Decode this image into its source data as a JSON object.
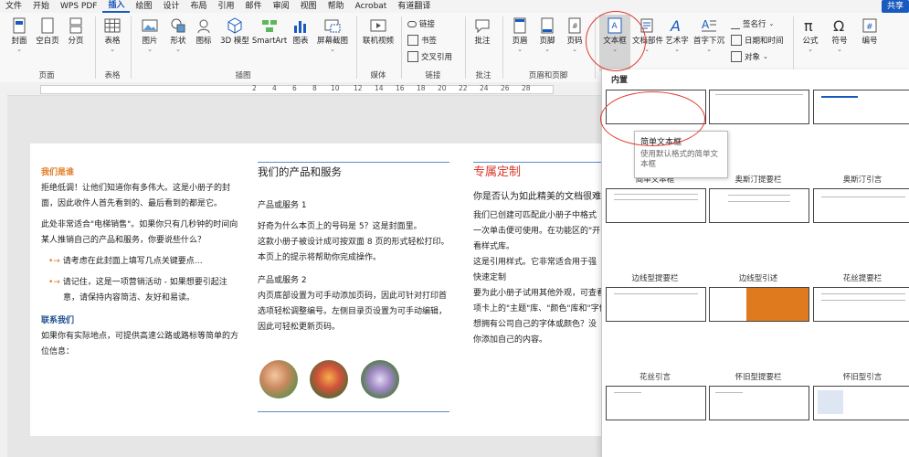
{
  "menu": {
    "items": [
      "文件",
      "开始",
      "WPS PDF",
      "插入",
      "绘图",
      "设计",
      "布局",
      "引用",
      "邮件",
      "审阅",
      "视图",
      "帮助",
      "Acrobat",
      "有道翻译"
    ],
    "active_index": 3,
    "share_label": "共享"
  },
  "ribbon": {
    "groups": {
      "pages": "页面",
      "table": "表格",
      "illustrations": "插图",
      "media": "媒体",
      "links": "链接",
      "comment": "批注",
      "header_footer": "页眉和页脚",
      "text": "文本",
      "symbols": "符号"
    },
    "buttons": {
      "cover": "封面",
      "blank": "空白页",
      "pagebreak": "分页",
      "table": "表格",
      "pictures": "图片",
      "shapes": "形状",
      "icons": "图标",
      "model3d": "3D 模型",
      "smartart": "SmartArt",
      "chart": "图表",
      "screenshot": "屏幕截图",
      "video": "联机视频",
      "link": "链接",
      "bookmark": "书签",
      "crossref": "交叉引用",
      "comment": "批注",
      "header": "页眉",
      "footer": "页脚",
      "pagenum": "页码",
      "textbox": "文本框",
      "quickparts": "文档部件",
      "wordart": "艺术字",
      "dropcap": "首字下沉",
      "signature": "签名行",
      "datetime": "日期和时间",
      "object": "对象",
      "equation": "公式",
      "symbol": "符号",
      "number": "编号"
    }
  },
  "ruler": {
    "numbers": [
      "2",
      "4",
      "6",
      "8",
      "10",
      "12",
      "14",
      "16",
      "18",
      "20",
      "22",
      "24",
      "26",
      "28"
    ]
  },
  "document": {
    "col1": {
      "heading": "我们是谁",
      "p1": [
        "拒绝低调！让他们知道你有多伟大。这是小册子的封",
        "面，因此收件人首先看到的、最后看到的都是它。"
      ],
      "p2": [
        "此处非常适合\"电梯销售\"。如果你只有几秒钟的时间向",
        "某人推销自己的产品和服务，你要说些什么？"
      ],
      "bullet1": "请考虑在此封面上填写几点关键要点…",
      "bullet2": [
        "请记住，这是一项营销活动 - 如果想要引起注",
        "意，请保持内容简洁、友好和易读。"
      ],
      "contact_heading": "联系我们",
      "contact": [
        "如果你有实际地点，可提供高速公路或路标等简单的方",
        "位信息："
      ]
    },
    "col2": {
      "heading": "我们的产品和服务",
      "sub1": "产品或服务 1",
      "p1": [
        "好奇为什么本页上的号码是 5？这是封面里。",
        "这款小册子被设计成可按双面 8 页的形式轻松打印。",
        "本页上的提示将帮助你完成操作。"
      ],
      "sub2": "产品或服务 2",
      "p2": [
        "内页底部设置为可手动添加页码，因此可针对打印首",
        "选项轻松调整编号。左侧目录页设置为可手动编辑，",
        "因此可轻松更新页码。"
      ]
    },
    "col3": {
      "heading": "专属定制",
      "sub": "你是否认为如此精美的文档很难设",
      "lines": [
        "我们已创建可匹配此小册子中格式",
        "一次单击便可使用。在功能区的\"开",
        "看样式库。",
        "这是引用样式。它非常适合用于强",
        "快速定制",
        "要为此小册子试用其他外观，可查看",
        "项卡上的\"主题\"库、\"颜色\"库和\"字体",
        "想拥有公司自己的字体或颜色？没",
        "你添加自己的内容。"
      ]
    }
  },
  "gallery": {
    "title": "内置",
    "tooltip_title": "简单文本框",
    "tooltip_desc": "使用默认格式的简单文本框",
    "items": [
      "简单文本框",
      "奥斯汀提要栏",
      "奥斯汀引言",
      "边线型提要栏",
      "边线型引述",
      "花丝提要栏",
      "花丝引言",
      "怀旧型提要栏",
      "怀旧型引言"
    ]
  },
  "colors": {
    "accent": "#185abd",
    "orange": "#e07a1f",
    "highlight": "#e23a2e"
  }
}
